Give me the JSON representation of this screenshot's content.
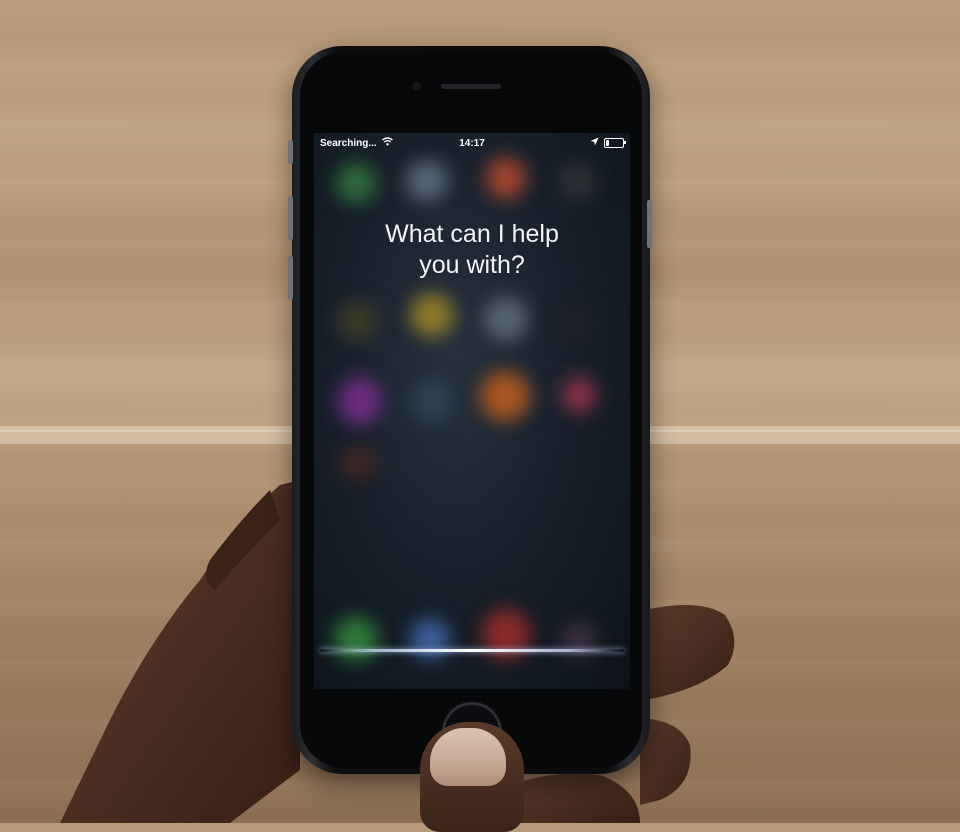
{
  "siri_screen": {
    "status_bar": {
      "carrier_text": "Searching...",
      "time": "14:17",
      "wifi_icon": "wifi-icon",
      "location_icon": "location-arrow-icon",
      "battery_icon": "battery-icon",
      "battery_level": 0.2
    },
    "prompt_line1": "What can I help",
    "prompt_line2": "you with?",
    "waveform_icon": "siri-waveform-icon"
  },
  "colors": {
    "prompt_text": "#f2f4f7",
    "screen_background": "#19212c",
    "waveform": "#ffffff"
  }
}
